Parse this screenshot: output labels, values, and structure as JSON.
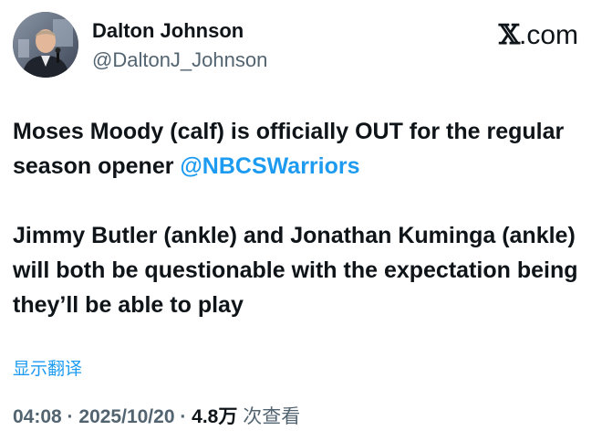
{
  "author": {
    "display_name": "Dalton Johnson",
    "handle": "@DaltonJ_Johnson",
    "avatar_icon": "profile-photo"
  },
  "brand": {
    "x_glyph": "𝕏",
    "text": ".com"
  },
  "tweet": {
    "paragraph1_text": "Moses Moody (calf) is officially OUT for the regular season opener ",
    "paragraph1_mention": "@NBCSWarriors",
    "paragraph2_text": "Jimmy Butler (ankle) and Jonathan Kuminga (ankle) will both be questionable with the expectation being they’ll be able to play"
  },
  "translate_label": "显示翻译",
  "meta": {
    "time": "04:08",
    "separator": " · ",
    "date": "2025/10/20",
    "views_count": "4.8万",
    "views_label": " 次查看"
  },
  "colors": {
    "text": "#0f1419",
    "secondary": "#536471",
    "link": "#1d9bf0"
  }
}
